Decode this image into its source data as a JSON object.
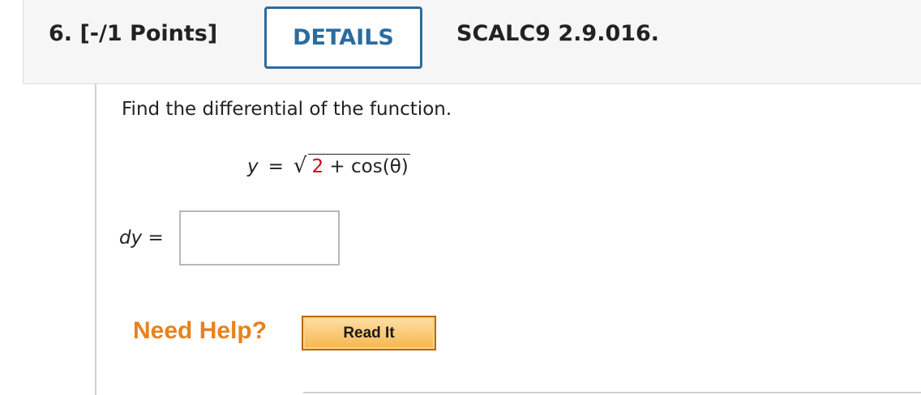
{
  "header": {
    "question_number": "6.",
    "points": "[-/1 Points]",
    "details_label": "DETAILS",
    "reference": "SCALC9 2.9.016."
  },
  "question": {
    "prompt": "Find the differential of the function.",
    "equation": {
      "lhs": "y",
      "equals": "=",
      "sqrt_symbol": "√",
      "radicand_number": "2",
      "radicand_rest": " + cos(θ)"
    },
    "answer": {
      "label_var": "dy",
      "label_eq": "=",
      "value": ""
    }
  },
  "help": {
    "need_help": "Need Help?",
    "read_it_label": "Read It"
  },
  "colors": {
    "accent": "#2a6ca0",
    "highlight_number": "#d0021b",
    "help_orange": "#e8821c"
  }
}
